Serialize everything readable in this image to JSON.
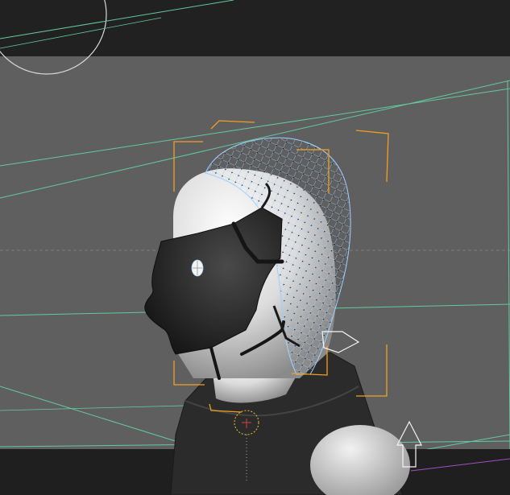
{
  "app": {
    "viewport_view": "perspective",
    "selected_object": "hair"
  },
  "colors": {
    "viewport_bg": "#5f5f5f",
    "top_bar": "#212121",
    "bottom_bar": "#1f1f1f",
    "scene_lines": "#63c9a0",
    "selection_bracket": "#f0a020",
    "mesh_wire": "#9fd0ff",
    "vertex": "#111111",
    "skin_white": "#e6e6e6",
    "face_black": "#2a2a2a"
  },
  "icons": {
    "navigation": "orbit-circle-icon",
    "transform_gizmo": "move-arrow-icon",
    "pivot": "pivot-circle-icon"
  }
}
